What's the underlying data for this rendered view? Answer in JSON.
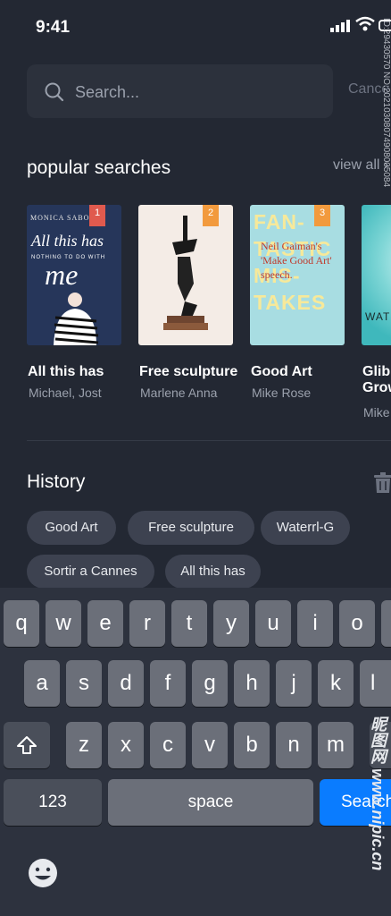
{
  "status_bar": {
    "time": "9:41"
  },
  "search": {
    "placeholder": "Search...",
    "cancel_label": "Cance"
  },
  "popular": {
    "title": "popular searches",
    "view_all": "view all",
    "books": [
      {
        "rank": "1",
        "title": "All this has",
        "author": "Michael, Jost",
        "cover_author": "MONICA SABOLO",
        "cover_title": "All this has",
        "cover_sub": "NOTHING TO DO WITH",
        "cover_me": "me"
      },
      {
        "rank": "2",
        "title": "Free sculpture",
        "author": "Marlene Anna"
      },
      {
        "rank": "3",
        "title": "Good Art",
        "author": "Mike Rose",
        "cover_big": "FAN-TASTIC MIS-TAKES",
        "cover_quote": "Neil Gaiman's 'Make Good Art' speech."
      },
      {
        "rank": "",
        "title": "Glib",
        "title2": "Grow",
        "author": "Mike",
        "cover_text": "WAT"
      }
    ]
  },
  "history": {
    "title": "History",
    "chips": [
      "Good Art",
      "Free sculpture",
      "Waterrl-G",
      "Sortir a Cannes",
      "All this has"
    ]
  },
  "keyboard": {
    "row1": [
      "q",
      "w",
      "e",
      "r",
      "t",
      "y",
      "u",
      "i",
      "o"
    ],
    "row2": [
      "a",
      "s",
      "d",
      "f",
      "g",
      "h",
      "j",
      "k",
      "l"
    ],
    "row3": [
      "z",
      "x",
      "c",
      "v",
      "b",
      "n",
      "m"
    ],
    "numbers_label": "123",
    "space_label": "space",
    "search_label": "Search"
  },
  "watermark": {
    "id_text": "ID:29430570 NO:20210308074908005084",
    "site": "昵图网 www.nipic.cn"
  },
  "colors": {
    "background": "#232833",
    "accent": "#0a7cff",
    "rank_red": "#e05a4e",
    "rank_orange": "#f29a3d"
  }
}
